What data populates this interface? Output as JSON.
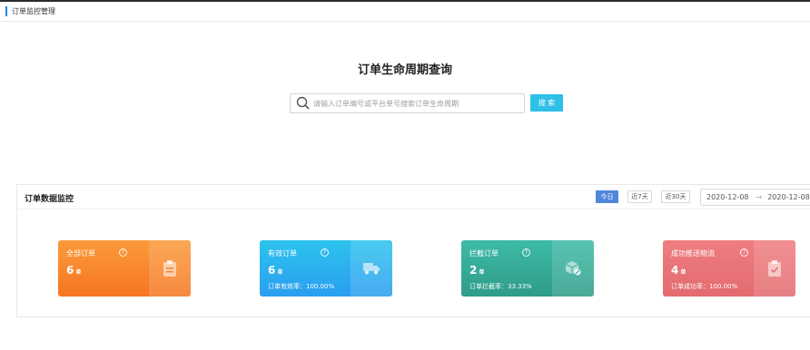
{
  "header": {
    "title": "订单监控管理"
  },
  "search": {
    "title": "订单生命周期查询",
    "placeholder": "请输入订单编号或平台单号搜索订单生命周期",
    "button_label": "搜 索"
  },
  "monitor": {
    "title": "订单数据监控",
    "ranges": [
      {
        "label": "今日",
        "active": true
      },
      {
        "label": "近7天",
        "active": false
      },
      {
        "label": "近30天",
        "active": false
      }
    ],
    "date_start": "2020-12-08",
    "date_sep": "→",
    "date_end": "2020-12-08",
    "cards": [
      {
        "label": "全部订单",
        "count": "6",
        "unit": "单",
        "rate": "",
        "icon": "clipboard-icon",
        "color": "#f5852a"
      },
      {
        "label": "有效订单",
        "count": "6",
        "unit": "单",
        "rate": "订单有效率：100.00%",
        "icon": "truck-icon",
        "color": "#2ab0ef"
      },
      {
        "label": "拦截订单",
        "count": "2",
        "unit": "单",
        "rate": "订单拦截率：33.33%",
        "icon": "package-block-icon",
        "color": "#35ab96"
      },
      {
        "label": "成功推送物流",
        "count": "4",
        "unit": "单",
        "rate": "订单成功率：100.00%",
        "icon": "clipboard-check-icon",
        "color": "#e97276"
      }
    ]
  }
}
